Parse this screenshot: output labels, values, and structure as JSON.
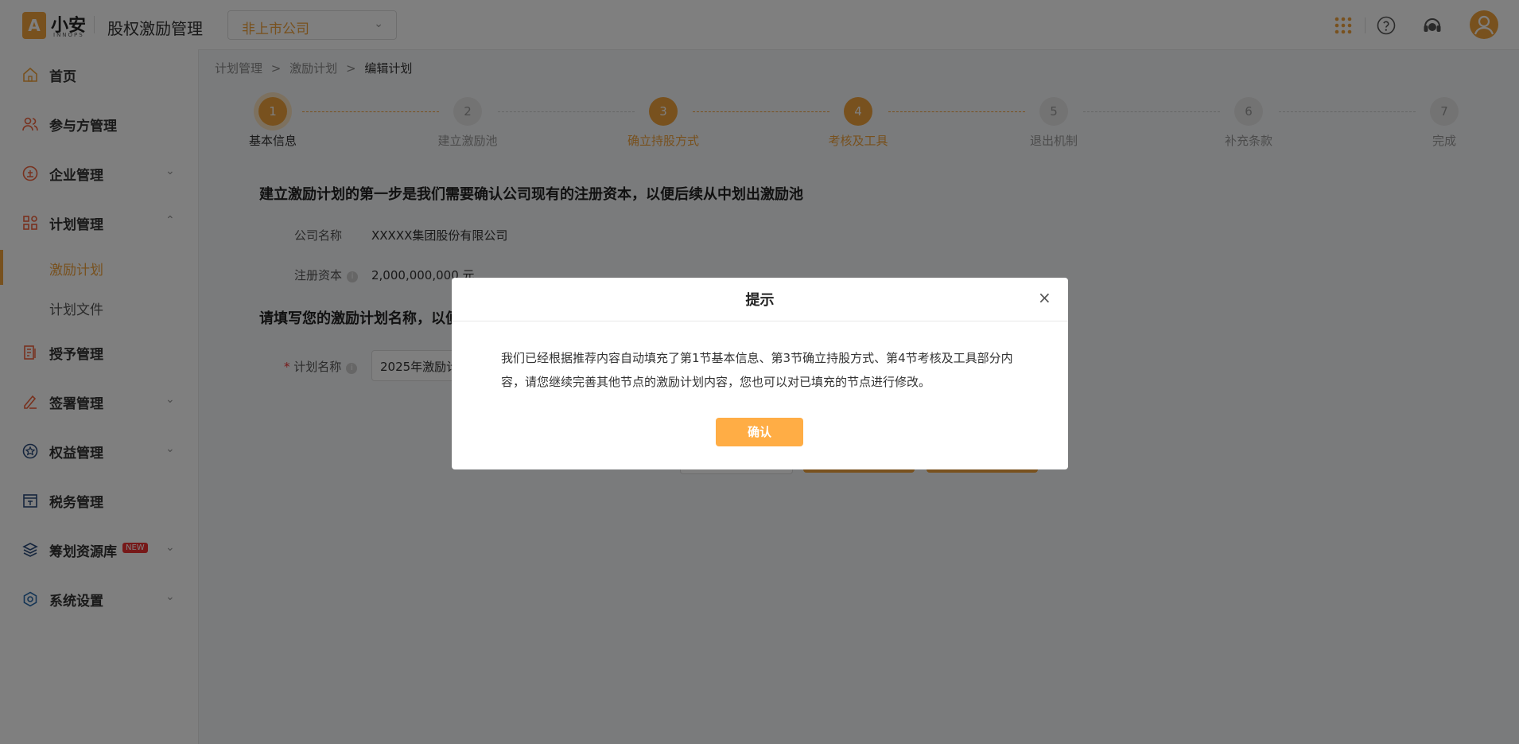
{
  "header": {
    "logo_mark": "A",
    "logo_text": "小安",
    "logo_sub": "INNOPS",
    "app_title": "股权激励管理",
    "company_select": "非上市公司"
  },
  "sidebar": {
    "items": [
      {
        "label": "首页",
        "icon": "home-icon"
      },
      {
        "label": "参与方管理",
        "icon": "users-icon"
      },
      {
        "label": "企业管理",
        "icon": "company-icon"
      },
      {
        "label": "计划管理",
        "icon": "plan-grid-icon"
      },
      {
        "label": "授予管理",
        "icon": "grant-icon"
      },
      {
        "label": "签署管理",
        "icon": "sign-icon"
      },
      {
        "label": "权益管理",
        "icon": "equity-icon"
      },
      {
        "label": "税务管理",
        "icon": "tax-icon"
      },
      {
        "label": "筹划资源库",
        "icon": "layers-icon",
        "badge": "NEW"
      },
      {
        "label": "系统设置",
        "icon": "settings-icon"
      }
    ],
    "sub_items": [
      {
        "label": "激励计划"
      },
      {
        "label": "计划文件"
      }
    ]
  },
  "breadcrumb": [
    "计划管理",
    "激励计划",
    "编辑计划"
  ],
  "steps": [
    {
      "num": "1",
      "name": "基本信息"
    },
    {
      "num": "2",
      "name": "建立激励池"
    },
    {
      "num": "3",
      "name": "确立持股方式"
    },
    {
      "num": "4",
      "name": "考核及工具"
    },
    {
      "num": "5",
      "name": "退出机制"
    },
    {
      "num": "6",
      "name": "补充条款"
    },
    {
      "num": "7",
      "name": "完成"
    }
  ],
  "form": {
    "section1_title": "建立激励计划的第一步是我们需要确认公司现有的注册资本，以便后续从中划出激励池",
    "company_label": "公司名称",
    "company_value": "XXXXX集团股份有限公司",
    "capital_label": "注册资本",
    "capital_value": "2,000,000,000 元",
    "section2_title": "请填写您的激励计划名称，以便",
    "plan_label": "计划名称",
    "plan_required": "*",
    "plan_value": "2025年激励计"
  },
  "modal": {
    "title": "提示",
    "body": "我们已经根据推荐内容自动填充了第1节基本信息、第3节确立持股方式、第4节考核及工具部分内容，请您继续完善其他节点的激励计划内容，您也可以对已填充的节点进行修改。",
    "confirm_label": "确认",
    "close_symbol": "×"
  },
  "colors": {
    "accent": "#f0a23c",
    "confirm_button": "#ffad45",
    "badge_red": "#e33333"
  }
}
